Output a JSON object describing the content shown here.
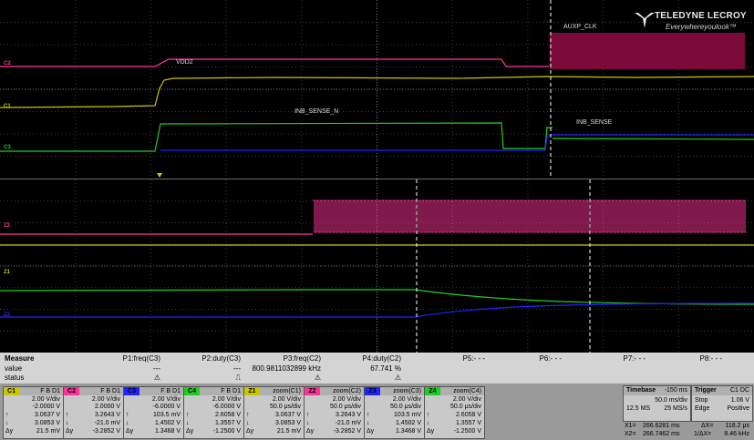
{
  "brand": {
    "name": "TELEDYNE LECROY",
    "tagline": "Everywhereyoulook™"
  },
  "trace_labels": {
    "auxp_clk": "AUXP_CLK",
    "vdd2": "VDD2",
    "inb_sense_n": "INB_SENSE_N",
    "inb_sense": "INB_SENSE"
  },
  "channel_markers": {
    "c2": "C2",
    "c1": "C1",
    "c3": "C3",
    "z2": "Z2",
    "z1": "Z1",
    "z3": "Z3"
  },
  "colors": {
    "c1": "#c8c800",
    "c2": "#ff3399",
    "c3": "#2222ff",
    "c4": "#22cc22",
    "z1": "#c8c800",
    "z2": "#ff3399",
    "z3": "#2222ff",
    "z4": "#22cc22",
    "clk_fill": "#7a0a3a"
  },
  "measure": {
    "label_measure": "Measure",
    "label_value": "value",
    "label_status": "status",
    "params": [
      {
        "name": "P1:freq(C3)",
        "value": "---",
        "status": "⚠"
      },
      {
        "name": "P2:duty(C3)",
        "value": "---",
        "status": "⎍"
      },
      {
        "name": "P3:freq(C2)",
        "value": "800.9811032899 kHz",
        "status": "⚠"
      },
      {
        "name": "P4:duty(C2)",
        "value": "67.741 %",
        "status": "⚠"
      },
      {
        "name": "P5:- - -",
        "value": "",
        "status": ""
      },
      {
        "name": "P6:- - -",
        "value": "",
        "status": ""
      },
      {
        "name": "P7:- - -",
        "value": "",
        "status": ""
      },
      {
        "name": "P8:- - -",
        "value": "",
        "status": ""
      }
    ]
  },
  "channels": [
    {
      "tag": "C1",
      "hdr": "F B D1",
      "vdiv": "2.00 V/div",
      "offset": "-2.0000 V",
      "r1k": "↑",
      "r1v": "3.0637 V",
      "r2k": "↓",
      "r2v": "3.0853 V",
      "r3k": "Δy",
      "r3v": "21.5 mV"
    },
    {
      "tag": "C2",
      "hdr": "F B D1",
      "vdiv": "2.00 V/div",
      "offset": "2.0000 V",
      "r1k": "↑",
      "r1v": "3.2643 V",
      "r2k": "↓",
      "r2v": "-21.0 mV",
      "r3k": "Δy",
      "r3v": "-3.2852 V"
    },
    {
      "tag": "C3",
      "hdr": "F B D1",
      "vdiv": "2.00 V/div",
      "offset": "-6.0000 V",
      "r1k": "↑",
      "r1v": "103.5 mV",
      "r2k": "↓",
      "r2v": "1.4502 V",
      "r3k": "Δy",
      "r3v": "1.3468 V"
    },
    {
      "tag": "C4",
      "hdr": "F B D1",
      "vdiv": "2.00 V/div",
      "offset": "-6.0000 V",
      "r1k": "↑",
      "r1v": "2.6058 V",
      "r2k": "↓",
      "r2v": "1.3557 V",
      "r3k": "Δy",
      "r3v": "-1.2500 V"
    },
    {
      "tag": "Z1",
      "hdr": "zoom(C1)",
      "vdiv": "2.00 V/div",
      "offset": "50.0 μs/div",
      "r1k": "↑",
      "r1v": "3.0637 V",
      "r2k": "↓",
      "r2v": "3.0853 V",
      "r3k": "Δy",
      "r3v": "21.5 mV"
    },
    {
      "tag": "Z2",
      "hdr": "zoom(C2)",
      "vdiv": "2.00 V/div",
      "offset": "50.0 μs/div",
      "r1k": "↑",
      "r1v": "3.2643 V",
      "r2k": "↓",
      "r2v": "-21.0 mV",
      "r3k": "Δy",
      "r3v": "-3.2852 V"
    },
    {
      "tag": "Z3",
      "hdr": "zoom(C3)",
      "vdiv": "2.00 V/div",
      "offset": "50.0 μs/div",
      "r1k": "↑",
      "r1v": "103.5 mV",
      "r2k": "↓",
      "r2v": "1.4502 V",
      "r3k": "Δy",
      "r3v": "1.3468 V"
    },
    {
      "tag": "Z4",
      "hdr": "zoom(C4)",
      "vdiv": "2.00 V/div",
      "offset": "50.0 μs/div",
      "r1k": "↑",
      "r1v": "2.6058 V",
      "r2k": "↓",
      "r2v": "1.3557 V",
      "r3k": "Δy",
      "r3v": "-1.2500 V"
    }
  ],
  "timebase": {
    "label": "Timebase",
    "delay": "-150 ms",
    "div": "50.0 ms/div",
    "samples": "12.5 MS",
    "rate": "25 MS/s"
  },
  "trigger": {
    "label": "Trigger",
    "source": "C1 DC",
    "mode": "Stop",
    "level": "1.06 V",
    "type": "Edge",
    "slope": "Positive"
  },
  "cursors": {
    "x1_label": "X1=",
    "x1": "266.6281 ms",
    "dx_label": "ΔX=",
    "dx": "118.2 μs",
    "x2_label": "X2=",
    "x2": "266.7462 ms",
    "inv_label": "1/ΔX=",
    "inv": "8.46 kHz"
  }
}
